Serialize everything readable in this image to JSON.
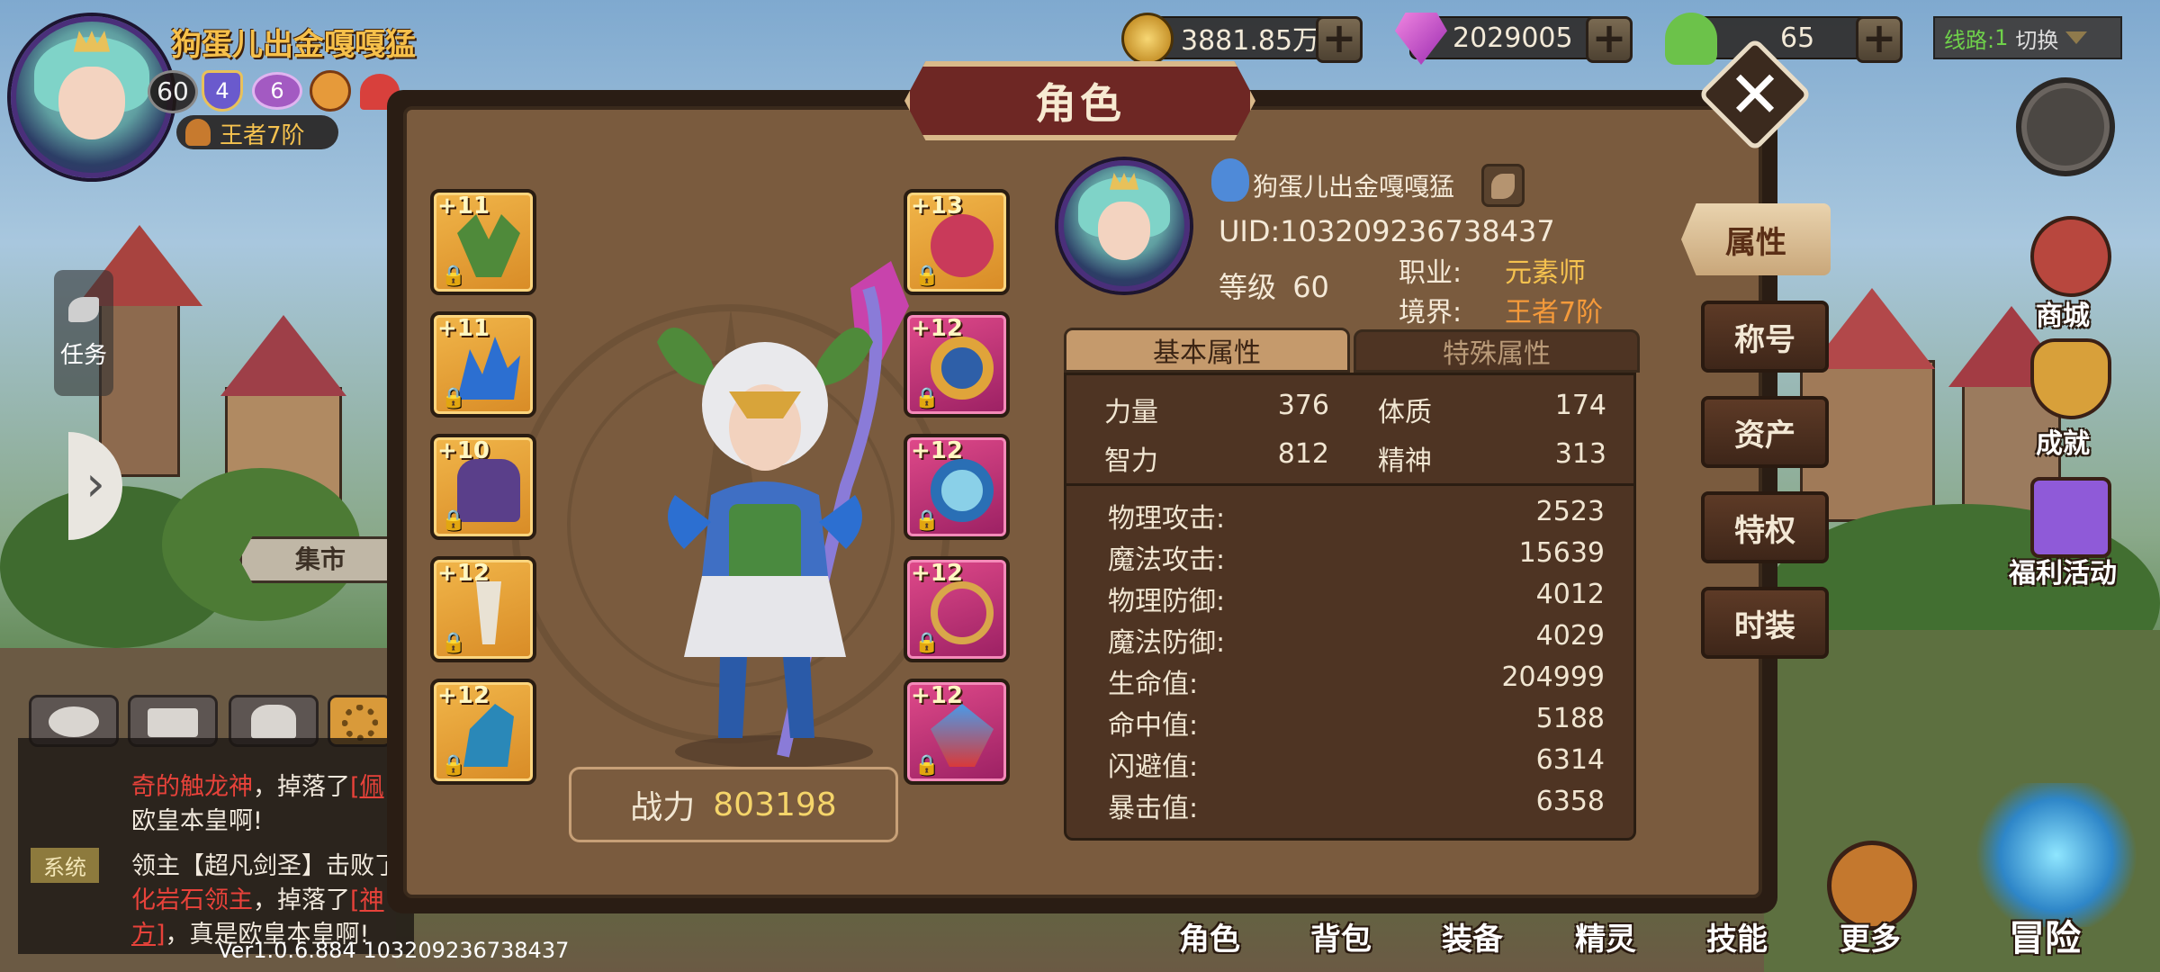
{
  "player": {
    "name": "狗蛋儿出金嘎嘎猛",
    "level": "60",
    "badges": [
      "4",
      "6"
    ],
    "rank": "王者7阶"
  },
  "resources": {
    "gold": "3881.85万",
    "gems": "2029005",
    "stamina": "65"
  },
  "server_line": {
    "label": "线路:",
    "number": "1",
    "switch_label": "切换"
  },
  "left_side": {
    "task_label": "任务",
    "market_label": "集市"
  },
  "dialog": {
    "title": "角色",
    "character_name": "狗蛋儿出金嘎嘎猛",
    "uid_label": "UID:",
    "uid": "103209236738437",
    "level_label": "等级",
    "level_value": "60",
    "job_label": "职业:",
    "job_value": "元素师",
    "realm_label": "境界:",
    "realm_value": "王者7阶",
    "power_label": "战力",
    "power_value": "803198",
    "tabs": [
      "基本属性",
      "特殊属性"
    ],
    "side_tabs": [
      "属性",
      "称号",
      "资产",
      "特权",
      "时装"
    ],
    "base_stats": [
      {
        "name": "力量",
        "value": "376"
      },
      {
        "name": "体质",
        "value": "174"
      },
      {
        "name": "智力",
        "value": "812"
      },
      {
        "name": "精神",
        "value": "313"
      }
    ],
    "combat_stats": [
      {
        "name": "物理攻击:",
        "value": "2523"
      },
      {
        "name": "魔法攻击:",
        "value": "15639"
      },
      {
        "name": "物理防御:",
        "value": "4012"
      },
      {
        "name": "魔法防御:",
        "value": "4029"
      },
      {
        "name": "生命值:",
        "value": "204999"
      },
      {
        "name": "命中值:",
        "value": "5188"
      },
      {
        "name": "闪避值:",
        "value": "6314"
      },
      {
        "name": "暴击值:",
        "value": "6358"
      }
    ],
    "equipment_left": [
      "+11",
      "+11",
      "+10",
      "+12",
      "+12"
    ],
    "equipment_right": [
      "+13",
      "+12",
      "+12",
      "+12",
      "+12"
    ]
  },
  "chat": {
    "line1_part1": "奇的触龙神",
    "line1_part2": "，掉落了",
    "line1_part3": "[佩",
    "line2": "欧皇本皇啊!",
    "tag": "系统",
    "line3_part1": "领主【超凡剑圣】击败了",
    "line4_part1": "化岩石领主",
    "line4_part2": "，掉落了",
    "line4_part3": "[神",
    "line5_part1": "方]",
    "line5_part2": "，真是欧皇本皇啊!"
  },
  "version": "Ver1.0.6.884 103209236738437",
  "right_menu": [
    "商城",
    "成就",
    "福利活动"
  ],
  "bottom_nav": [
    "角色",
    "背包",
    "装备",
    "精灵",
    "技能",
    "更多",
    "冒险"
  ]
}
